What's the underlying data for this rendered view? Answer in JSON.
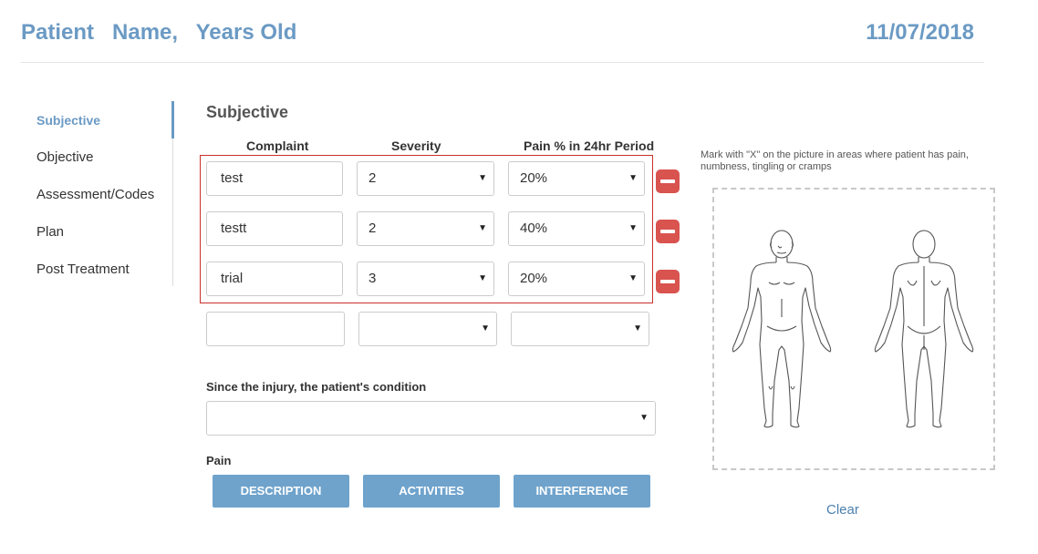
{
  "header": {
    "patient_line": "Patient   Name,   Years Old",
    "date": "11/07/2018"
  },
  "nav": {
    "items": [
      "Subjective",
      "Objective",
      "Assessment/Codes",
      "Plan",
      "Post Treatment"
    ],
    "active": "Subjective"
  },
  "section": {
    "title": "Subjective",
    "columns": [
      "Complaint",
      "Severity",
      "Pain % in 24hr Period"
    ],
    "rows": [
      {
        "complaint": "test",
        "severity": "2",
        "pain": "20%"
      },
      {
        "complaint": "testt",
        "severity": "2",
        "pain": "40%"
      },
      {
        "complaint": "trial",
        "severity": "3",
        "pain": "20%"
      },
      {
        "complaint": "",
        "severity": "",
        "pain": ""
      }
    ],
    "condition_label": "Since the injury, the patient's condition",
    "condition_value": "",
    "pain_label": "Pain",
    "buttons": [
      "DESCRIPTION",
      "ACTIVITIES",
      "INTERFERENCE"
    ]
  },
  "body_chart": {
    "instruction": "Mark with \"X\" on the picture in areas where patient has pain, numbness, tingling or cramps",
    "clear_label": "Clear"
  },
  "colors": {
    "accent": "#6b9ac4",
    "button": "#6fa3cc",
    "remove": "#d9534f",
    "highlight_border": "#c9302c"
  },
  "icons": [
    "remove-row-icon",
    "dropdown-caret-icon"
  ]
}
